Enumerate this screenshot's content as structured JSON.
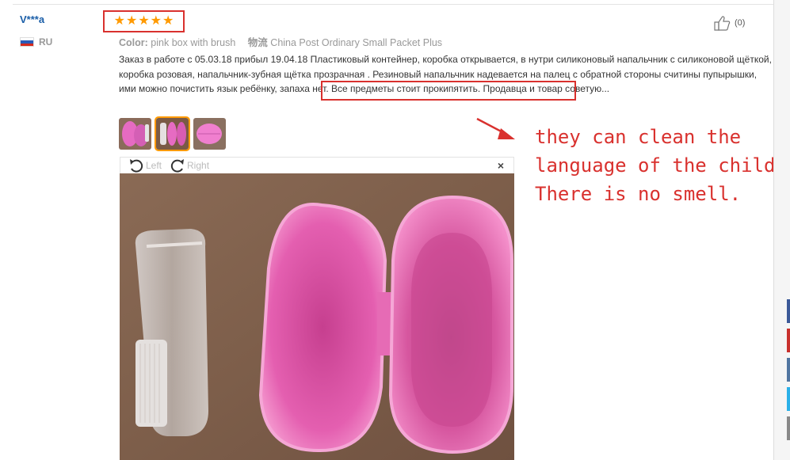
{
  "review": {
    "user": "V***a",
    "country": "RU",
    "stars": 5,
    "helpful_count": "(0)",
    "color_label": "Color:",
    "color_value": "pink box with brush",
    "shipping_label": "物流",
    "shipping_value": "China Post Ordinary Small Packet Plus",
    "text": "Заказ в работе с 05.03.18 прибыл 19.04.18 Пластиковый контейнер, коробка открывается, в нутри силиконовый напальчник с силиконовой щёткой, коробка розовая, напальчник-зубная щётка прозрачная . Резиновый напальчник надевается на палец с обратной стороны считины пупырышки, ими можно почистить язык ребёнку, запаха нет. Все предметы стоит прокипятить. Продавца и товар советую..."
  },
  "viewer": {
    "left_label": "Left",
    "right_label": "Right",
    "close_label": "×"
  },
  "annotation": {
    "line1": "they can clean the",
    "line2": "language of the child.",
    "line3": "There is no smell."
  },
  "colors": {
    "accent_red": "#d9312e",
    "star_orange": "#ff9a00",
    "user_blue": "#1a5ea8"
  },
  "icons": [
    "thumbs-up-icon",
    "rotate-left-icon",
    "rotate-right-icon",
    "close-icon",
    "star-icon",
    "ru-flag-icon",
    "arrow-icon"
  ]
}
